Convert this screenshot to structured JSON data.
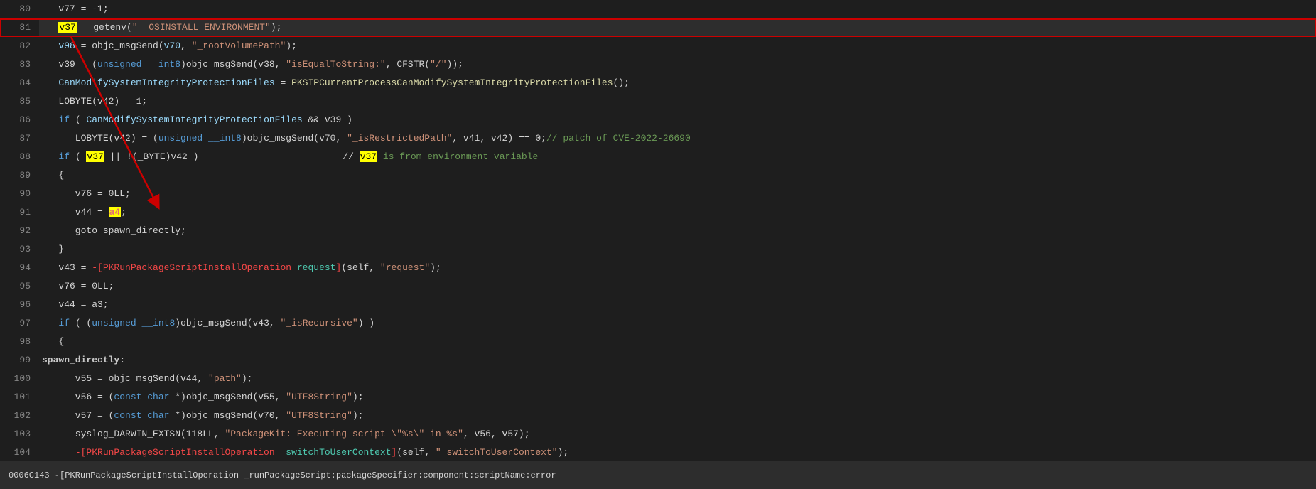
{
  "lines": [
    {
      "number": "80",
      "highlight": false,
      "tokens": [
        {
          "text": "   v77 = -1;",
          "class": "plain"
        }
      ]
    },
    {
      "number": "81",
      "highlight": true,
      "tokens": [
        {
          "text": "   ",
          "class": "plain"
        },
        {
          "text": "v37",
          "class": "highlight-yellow"
        },
        {
          "text": " = getenv(\"__OSINSTALL_ENVIRONMENT\");",
          "class": "plain"
        }
      ]
    },
    {
      "number": "82",
      "highlight": false,
      "tokens": [
        {
          "text": "   ",
          "class": "plain"
        },
        {
          "text": "v98",
          "class": "var"
        },
        {
          "text": " = objc_msgSend(",
          "class": "plain"
        },
        {
          "text": "v70",
          "class": "var"
        },
        {
          "text": ", \"_rootVolumePath\");",
          "class": "plain"
        }
      ]
    },
    {
      "number": "83",
      "highlight": false,
      "tokens": [
        {
          "text": "   v39 = (unsigned __int8)objc_msgSend(v38, \"isEqualToString:\", CFSTR(\"/\"));",
          "class": "plain"
        }
      ]
    },
    {
      "number": "84",
      "highlight": false,
      "tokens": [
        {
          "text": "   CanModifySystemIntegrityProtectionFiles = PKSIPCurrentProcessCanModifySystemIntegrityProtectionFiles();",
          "class": "plain",
          "special": "can-modify"
        }
      ]
    },
    {
      "number": "85",
      "highlight": false,
      "tokens": [
        {
          "text": "   LOBYTE(v42) = 1;",
          "class": "plain"
        }
      ]
    },
    {
      "number": "86",
      "highlight": false,
      "tokens": [
        {
          "text": "   if ( CanModifySystemIntegrityProtectionFiles && v39 )",
          "class": "plain",
          "special": "if-can-modify"
        }
      ]
    },
    {
      "number": "87",
      "highlight": false,
      "tokens": [
        {
          "text": "      LOBYTE(v42) = (unsigned __int8)objc_msgSend(v70, \"_isRestrictedPath\", v41, v42) == 0;",
          "class": "plain"
        },
        {
          "text": "// patch of CVE-2022-26690",
          "class": "cmt-inline"
        }
      ]
    },
    {
      "number": "88",
      "highlight": false,
      "tokens": [
        {
          "text": "   if ( ",
          "class": "plain"
        },
        {
          "text": "v37",
          "class": "highlight-yellow"
        },
        {
          "text": " || !(_BYTE)v42 )                          //",
          "class": "plain"
        },
        {
          "text": " v37",
          "class": "highlight-yellow"
        },
        {
          "text": " is from environment variable",
          "class": "cmt-inline"
        }
      ]
    },
    {
      "number": "89",
      "highlight": false,
      "tokens": [
        {
          "text": "   {",
          "class": "plain"
        }
      ]
    },
    {
      "number": "90",
      "highlight": false,
      "tokens": [
        {
          "text": "      v76 = 0LL;",
          "class": "plain"
        }
      ]
    },
    {
      "number": "91",
      "highlight": false,
      "tokens": [
        {
          "text": "      v44 = ",
          "class": "plain"
        },
        {
          "text": "a4",
          "class": "red-cursor"
        },
        {
          "text": ";",
          "class": "plain"
        }
      ]
    },
    {
      "number": "92",
      "highlight": false,
      "tokens": [
        {
          "text": "      goto spawn_directly;",
          "class": "plain"
        }
      ]
    },
    {
      "number": "93",
      "highlight": false,
      "tokens": [
        {
          "text": "   }",
          "class": "plain"
        }
      ]
    },
    {
      "number": "94",
      "highlight": false,
      "tokens": [
        {
          "text": "   v43 = -[PKRunPackageScriptInstallOperation request](self, \"request\");",
          "class": "plain",
          "special": "v43"
        }
      ]
    },
    {
      "number": "95",
      "highlight": false,
      "tokens": [
        {
          "text": "   v76 = 0LL;",
          "class": "plain"
        }
      ]
    },
    {
      "number": "96",
      "highlight": false,
      "tokens": [
        {
          "text": "   v44 = a3;",
          "class": "plain"
        }
      ]
    },
    {
      "number": "97",
      "highlight": false,
      "tokens": [
        {
          "text": "   if ( (unsigned __int8)objc_msgSend(v43, \"_isRecursive\") )",
          "class": "plain"
        }
      ]
    },
    {
      "number": "98",
      "highlight": false,
      "tokens": [
        {
          "text": "   {",
          "class": "plain"
        }
      ]
    },
    {
      "number": "99",
      "highlight": false,
      "tokens": [
        {
          "text": "spawn_directly:",
          "class": "label-text"
        }
      ]
    },
    {
      "number": "100",
      "highlight": false,
      "tokens": [
        {
          "text": "      v55 = objc_msgSend(v44, \"path\");",
          "class": "plain"
        }
      ]
    },
    {
      "number": "101",
      "highlight": false,
      "tokens": [
        {
          "text": "      v56 = (const char *)objc_msgSend(v55, \"UTF8String\");",
          "class": "plain"
        }
      ]
    },
    {
      "number": "102",
      "highlight": false,
      "tokens": [
        {
          "text": "      v57 = (const char *)objc_msgSend(v70, \"UTF8String\");",
          "class": "plain"
        }
      ]
    },
    {
      "number": "103",
      "highlight": false,
      "tokens": [
        {
          "text": "      syslog_DARWIN_EXTSN(118LL, \"PackageKit: Executing script \\\"%s\\\" in %s\", v56, v57);",
          "class": "plain"
        }
      ]
    },
    {
      "number": "104",
      "highlight": false,
      "tokens": [
        {
          "text": "      -[PKRunPackageScriptInstallOperation _switchToUserContext](self, \"_switchToUserContext\");",
          "class": "plain"
        }
      ]
    }
  ],
  "status_bar": {
    "text": "0006C143 -[PKRunPackageScriptInstallOperation _runPackageScript:packageSpecifier:component:scriptName:error"
  },
  "colors": {
    "background": "#1e1e1e",
    "line_highlight": "#2d2d2d",
    "border_red": "#cc0000",
    "line_number": "#858585",
    "plain": "#d4d4d4",
    "variable": "#9cdcfe",
    "function": "#dcdcaa",
    "keyword": "#569cd6",
    "string": "#ce9178",
    "comment": "#6a9955",
    "highlight_yellow_bg": "#ffff00",
    "highlight_yellow_fg": "#000000"
  }
}
